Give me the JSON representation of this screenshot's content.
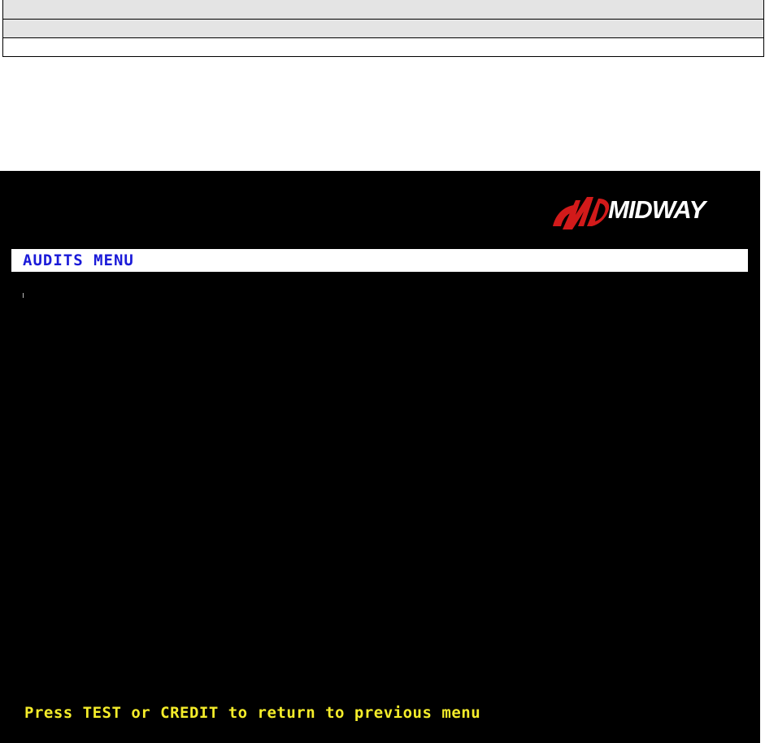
{
  "screen": {
    "logo": {
      "brand": "MIDWAY",
      "icon": "midway-m-icon",
      "accent": "#d21a1a"
    },
    "menu_title": "AUDITS MENU",
    "footer_prompt": "Press TEST or CREDIT to return to previous menu",
    "colors": {
      "background": "#000000",
      "title_bar": "#ffffff",
      "title_text": "#1a1ad8",
      "footer_text": "#f4ec2a"
    }
  }
}
